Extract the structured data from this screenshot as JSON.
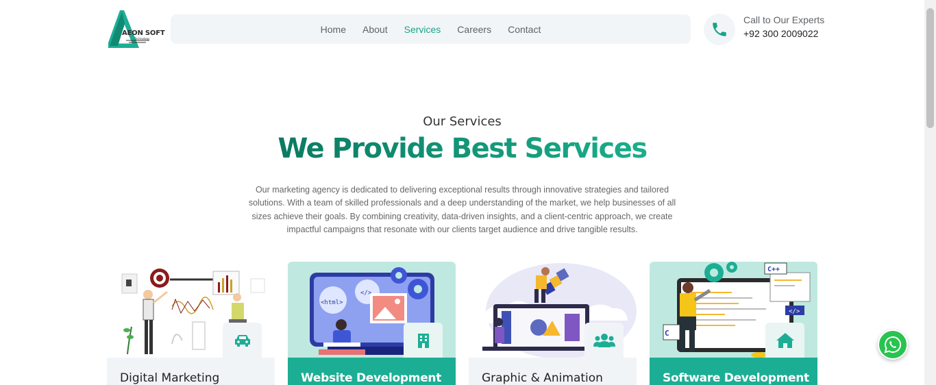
{
  "brand": {
    "name": "AEON SOFT",
    "tagline": "Technology",
    "accent": "#19a48a",
    "headline_gradient": [
      "#0b7a62",
      "#1cb591"
    ]
  },
  "nav": {
    "items": [
      {
        "label": "Home",
        "active": false
      },
      {
        "label": "About",
        "active": false
      },
      {
        "label": "Services",
        "active": true
      },
      {
        "label": "Careers",
        "active": false
      },
      {
        "label": "Contact",
        "active": false
      }
    ]
  },
  "contact": {
    "icon": "phone-icon",
    "label": "Call to Our Experts",
    "number": "+92 300 2009022"
  },
  "services_section": {
    "eyebrow": "Our Services",
    "headline": "We Provide Best Services",
    "description": "Our marketing agency is dedicated to delivering exceptional results through innovative strategies and tailored solutions. With a team of skilled professionals and a deep understanding of the market, we help businesses of all sizes achieve their goals. By combining creativity, data-driven insights, and a client-centric approach, we create impactful campaigns that resonate with our clients target audience and drive tangible results."
  },
  "cards": [
    {
      "title": "Digital Marketing",
      "icon": "car-icon",
      "style": "light"
    },
    {
      "title": "Website Development",
      "icon": "building-icon",
      "style": "teal"
    },
    {
      "title": "Graphic & Animation",
      "icon": "users-icon",
      "style": "light"
    },
    {
      "title": "Software Development",
      "icon": "home-icon",
      "style": "teal"
    }
  ],
  "floating": {
    "icon": "whatsapp-icon",
    "color": "#29c34f"
  }
}
